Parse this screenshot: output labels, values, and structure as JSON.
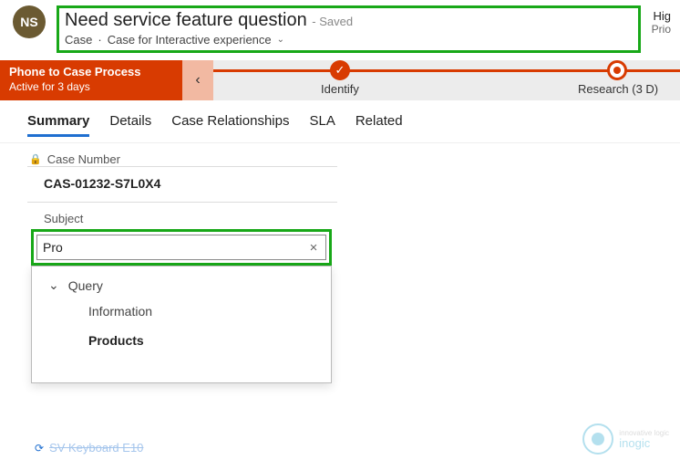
{
  "header": {
    "avatar_initials": "NS",
    "title": "Need service feature question",
    "saved_suffix": "- Saved",
    "entity": "Case",
    "form_name": "Case for Interactive experience",
    "right_label": "Hig",
    "right_value": "Prio"
  },
  "process": {
    "name": "Phone to Case Process",
    "duration": "Active for 3 days",
    "back_glyph": "‹",
    "identify_label": "Identify",
    "research_label": "Research  (3 D)"
  },
  "tabs": {
    "summary": "Summary",
    "details": "Details",
    "relationships": "Case Relationships",
    "sla": "SLA",
    "related": "Related"
  },
  "form": {
    "case_number_label": "Case Number",
    "case_number_value": "CAS-01232-S7L0X4",
    "subject_label": "Subject",
    "subject_value": "Pro",
    "clear_glyph": "×",
    "dd_chev": "⌄",
    "dd_group": "Query",
    "dd_item1": "Information",
    "dd_item2": "Products"
  },
  "footer": {
    "cutoff_text": "SV Keyboard E10",
    "cutoff_icon": "⟳",
    "logo_small": "innovative logic",
    "logo_name": "inogic"
  }
}
